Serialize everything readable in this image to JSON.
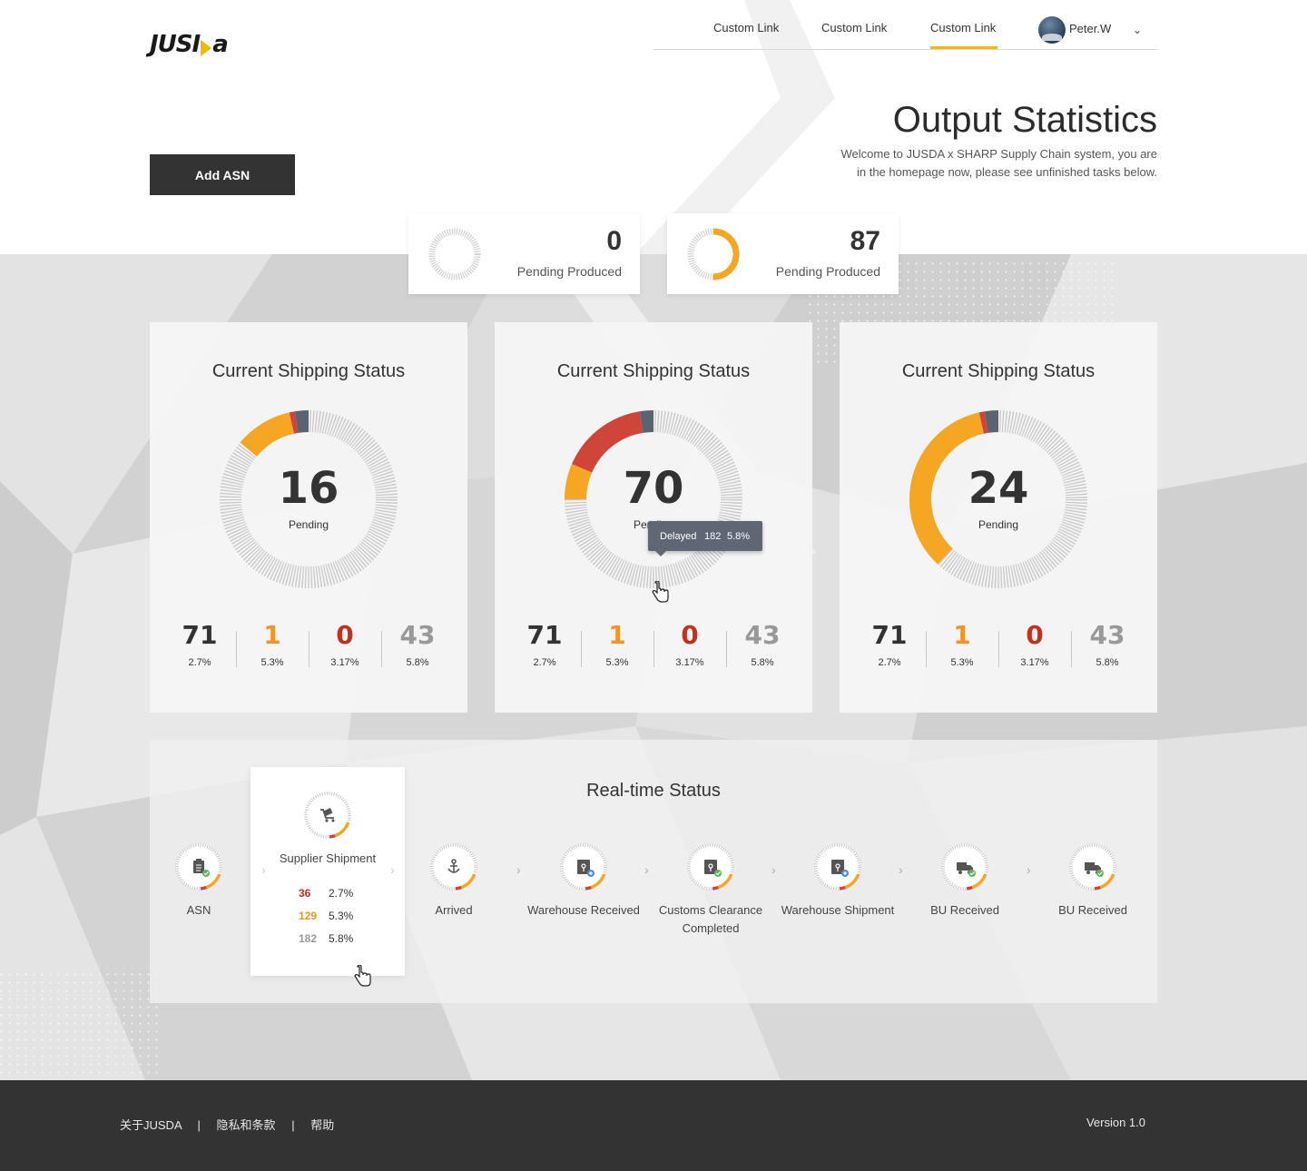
{
  "header": {
    "logo": "JUSDA",
    "nav": [
      "Custom Link",
      "Custom Link",
      "Custom Link"
    ],
    "active_nav_index": 2,
    "user": "Peter.W"
  },
  "hero": {
    "title": "Output Statistics",
    "welcome": "Welcome to JUSDA x SHARP Supply Chain system, you are in the homepage now, please see unfinished tasks below.",
    "add_button": "Add ASN"
  },
  "colors": {
    "accent": "#f5b800",
    "orange": "#f0952a",
    "red": "#c0321d",
    "grey": "#999999",
    "dark": "#333333",
    "footer": "#333333"
  },
  "pending_cards": [
    {
      "value": "0",
      "label": "Pending Produced",
      "progress": 0
    },
    {
      "value": "87",
      "label": "Pending Produced",
      "progress": 0.5
    }
  ],
  "status_cards": [
    {
      "title": "Current Shipping Status",
      "number": "16",
      "sub": "Pending",
      "arc_fraction": 0.14,
      "stats": [
        {
          "value": "71",
          "pct": "2.7%"
        },
        {
          "value": "1",
          "pct": "5.3%"
        },
        {
          "value": "0",
          "pct": "3.17%"
        },
        {
          "value": "43",
          "pct": "5.8%"
        }
      ]
    },
    {
      "title": "Current Shipping Status",
      "number": "70",
      "sub": "Pending",
      "arc_fraction": 0.25,
      "tooltip": {
        "label": "Delayed",
        "value": "182",
        "pct": "5.8%"
      },
      "stats": [
        {
          "value": "71",
          "pct": "2.7%"
        },
        {
          "value": "1",
          "pct": "5.3%"
        },
        {
          "value": "0",
          "pct": "3.17%"
        },
        {
          "value": "43",
          "pct": "5.8%"
        }
      ]
    },
    {
      "title": "Current Shipping Status",
      "number": "24",
      "sub": "Pending",
      "arc_fraction": 0.38,
      "stats": [
        {
          "value": "71",
          "pct": "2.7%"
        },
        {
          "value": "1",
          "pct": "5.3%"
        },
        {
          "value": "0",
          "pct": "3.17%"
        },
        {
          "value": "43",
          "pct": "5.8%"
        }
      ]
    }
  ],
  "realtime": {
    "title": "Real-time Status",
    "steps": [
      {
        "label": "ASN",
        "icon": "clipboard-icon"
      },
      {
        "label": "Supplier Shipment",
        "icon": "cart-icon"
      },
      {
        "label": "Arrived",
        "icon": "anchor-icon"
      },
      {
        "label": "Warehouse Received",
        "icon": "warehouse-icon"
      },
      {
        "label": "Customs Clearance Completed",
        "icon": "customs-icon"
      },
      {
        "label": "Warehouse Shipment",
        "icon": "warehouse-icon"
      },
      {
        "label": "BU Received",
        "icon": "truck-icon"
      },
      {
        "label": "BU Received",
        "icon": "truck-icon"
      }
    ],
    "popup_rows": [
      {
        "value": "36",
        "pct": "2.7%"
      },
      {
        "value": "129",
        "pct": "5.3%"
      },
      {
        "value": "182",
        "pct": "5.8%"
      }
    ]
  },
  "footer": {
    "links": [
      "关于JUSDA",
      "隐私和条款",
      "帮助"
    ],
    "separator": "|",
    "version": "Version 1.0"
  }
}
